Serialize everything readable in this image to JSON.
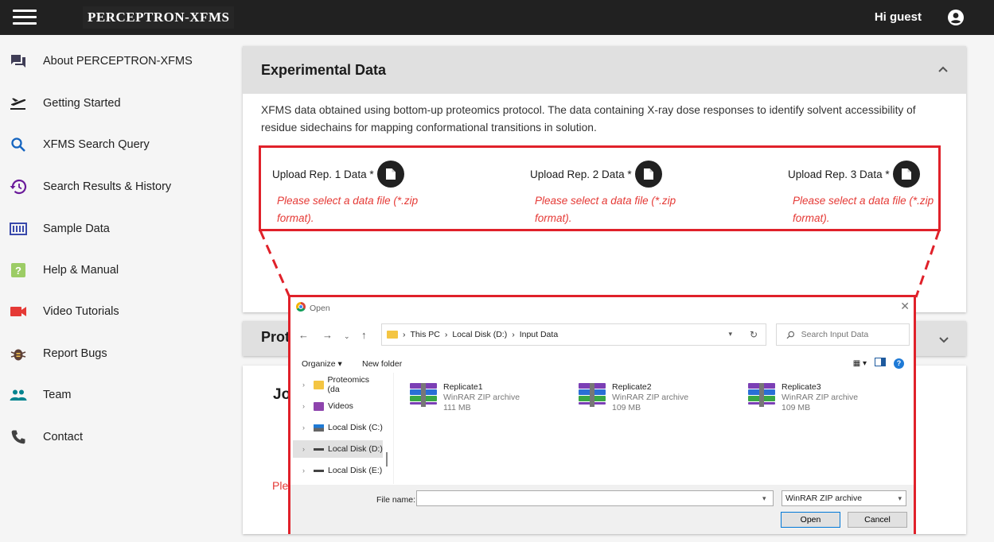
{
  "header": {
    "logo_text": "PERCEPTRON-XFMS",
    "greeting": "Hi guest",
    "icons": {
      "menu": "hamburger-icon",
      "user": "account-circle-icon"
    }
  },
  "sidebar": {
    "items": [
      {
        "label": "About PERCEPTRON-XFMS",
        "icon": "forum-icon",
        "color": "#3f3d56"
      },
      {
        "label": "Getting Started",
        "icon": "flight-takeoff-icon",
        "color": "#212121"
      },
      {
        "label": "XFMS Search Query",
        "icon": "search-icon",
        "color": "#1565c0"
      },
      {
        "label": "Search Results & History",
        "icon": "history-icon",
        "color": "#6a1b9a"
      },
      {
        "label": "Sample Data",
        "icon": "data-table-icon",
        "color": "#3949ab"
      },
      {
        "label": "Help & Manual",
        "icon": "help-box-icon",
        "color": "#9ccc65"
      },
      {
        "label": "Video Tutorials",
        "icon": "videocam-icon",
        "color": "#e53935"
      },
      {
        "label": "Report Bugs",
        "icon": "bug-icon",
        "color": "#5d4037"
      },
      {
        "label": "Team",
        "icon": "people-icon",
        "color": "#00838f"
      },
      {
        "label": "Contact",
        "icon": "phone-icon",
        "color": "#424242"
      }
    ]
  },
  "experimental": {
    "title": "Experimental Data",
    "description": "XFMS data obtained using bottom-up proteomics protocol. The data containing X-ray dose responses to identify solvent accessibility of residue sidechains for mapping conformational transitions in solution.",
    "uploads": [
      {
        "label": "Upload Rep. 1 Data *",
        "hint": "Please select a data file (*.zip format)."
      },
      {
        "label": "Upload Rep. 2 Data *",
        "hint": "Please select a data file (*.zip format)."
      },
      {
        "label": "Upload Rep. 3 Data *",
        "hint": "Please select a data file (*.zip format)."
      }
    ]
  },
  "second_panel": {
    "title_partial": "Prot",
    "heading_partial": "Jo",
    "hint_partial": "Ple"
  },
  "dialog": {
    "title": "Open",
    "close": "✕",
    "breadcrumb": [
      "This PC",
      "Local Disk (D:)",
      "Input Data"
    ],
    "search_placeholder": "Search Input Data",
    "organize": "Organize ▾",
    "new_folder": "New folder",
    "tree": [
      {
        "label": "Proteomics (da",
        "icon": "folder-icon"
      },
      {
        "label": "Videos",
        "icon": "videos-icon"
      },
      {
        "label": "Local Disk (C:)",
        "icon": "windows-drive-icon"
      },
      {
        "label": "Local Disk (D:)",
        "icon": "drive-icon"
      },
      {
        "label": "Local Disk (E:)",
        "icon": "drive-icon"
      }
    ],
    "files": [
      {
        "name": "Replicate1",
        "type": "WinRAR ZIP archive",
        "size": "111 MB"
      },
      {
        "name": "Replicate2",
        "type": "WinRAR ZIP archive",
        "size": "109 MB"
      },
      {
        "name": "Replicate3",
        "type": "WinRAR ZIP archive",
        "size": "109 MB"
      }
    ],
    "file_name_label": "File name:",
    "file_name_value": "",
    "file_type": "WinRAR ZIP archive",
    "open_button": "Open",
    "cancel_button": "Cancel",
    "accent_color": "#e0212a"
  }
}
